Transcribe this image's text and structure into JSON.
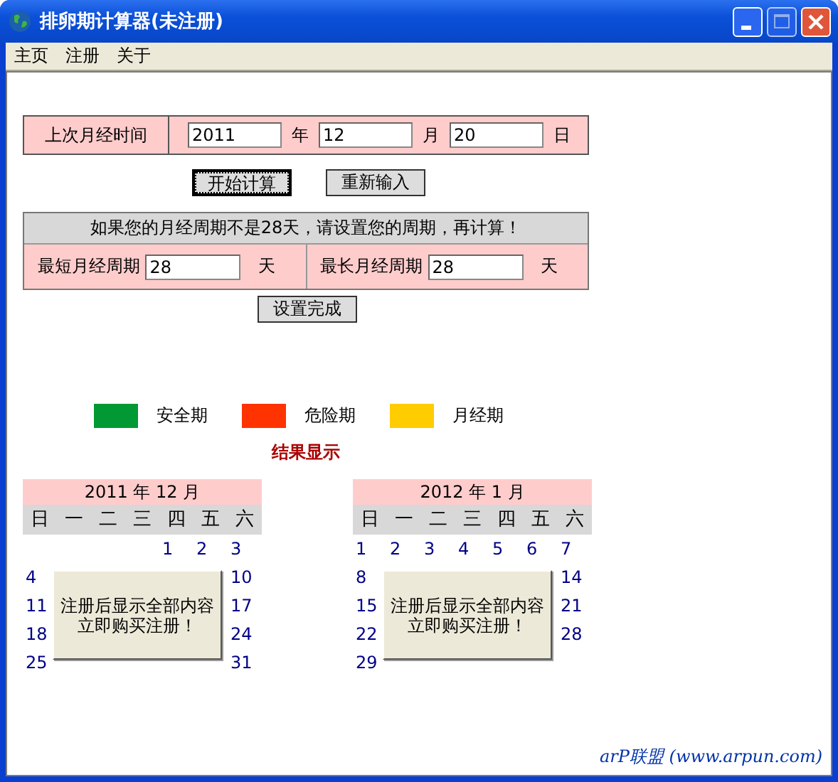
{
  "window": {
    "title": "排卵期计算器(未注册)"
  },
  "menu": [
    "主页",
    "注册",
    "关于"
  ],
  "last_period": {
    "label": "上次月经时间",
    "year": "2011",
    "year_unit": "年",
    "month": "12",
    "month_unit": "月",
    "day": "20",
    "day_unit": "日"
  },
  "buttons": [
    {
      "label": "开始计算",
      "focused": true
    },
    {
      "label": "重新输入",
      "focused": false
    }
  ],
  "cycle": {
    "notice": "如果您的月经周期不是28天，请设置您的周期，再计算！",
    "fields": [
      {
        "label": "最短月经周期",
        "value": "28",
        "unit": "天"
      },
      {
        "label": "最长月经周期",
        "value": "28",
        "unit": "天"
      }
    ],
    "button": "设置完成"
  },
  "legend": [
    {
      "label": "安全期",
      "color": "#009933"
    },
    {
      "label": "危险期",
      "color": "#ff3300"
    },
    {
      "label": "月经期",
      "color": "#ffcc00"
    }
  ],
  "result_title": "结果显示",
  "calendars": [
    {
      "title": "2011 年 12 月",
      "weekdays": [
        "日",
        "一",
        "二",
        "三",
        "四",
        "五",
        "六"
      ],
      "first_row": [
        "1",
        "2",
        "3"
      ],
      "rows": [
        {
          "first": "4",
          "last": "10"
        },
        {
          "first": "11",
          "last": "17"
        },
        {
          "first": "18",
          "last": "24"
        },
        {
          "first": "25",
          "last": "31"
        }
      ],
      "overlay": [
        "注册后显示全部内容",
        "立即购买注册！"
      ]
    },
    {
      "title": "2012 年 1 月",
      "weekdays": [
        "日",
        "一",
        "二",
        "三",
        "四",
        "五",
        "六"
      ],
      "first_row": [
        "1",
        "2",
        "3",
        "4",
        "5",
        "6",
        "7"
      ],
      "rows": [
        {
          "first": "8",
          "last": "14"
        },
        {
          "first": "15",
          "last": "21"
        },
        {
          "first": "22",
          "last": "28"
        },
        {
          "first": "29"
        }
      ],
      "overlay": [
        "注册后显示全部内容",
        "立即购买注册！"
      ]
    }
  ],
  "footer": "arP联盟 (www.arpun.com)"
}
